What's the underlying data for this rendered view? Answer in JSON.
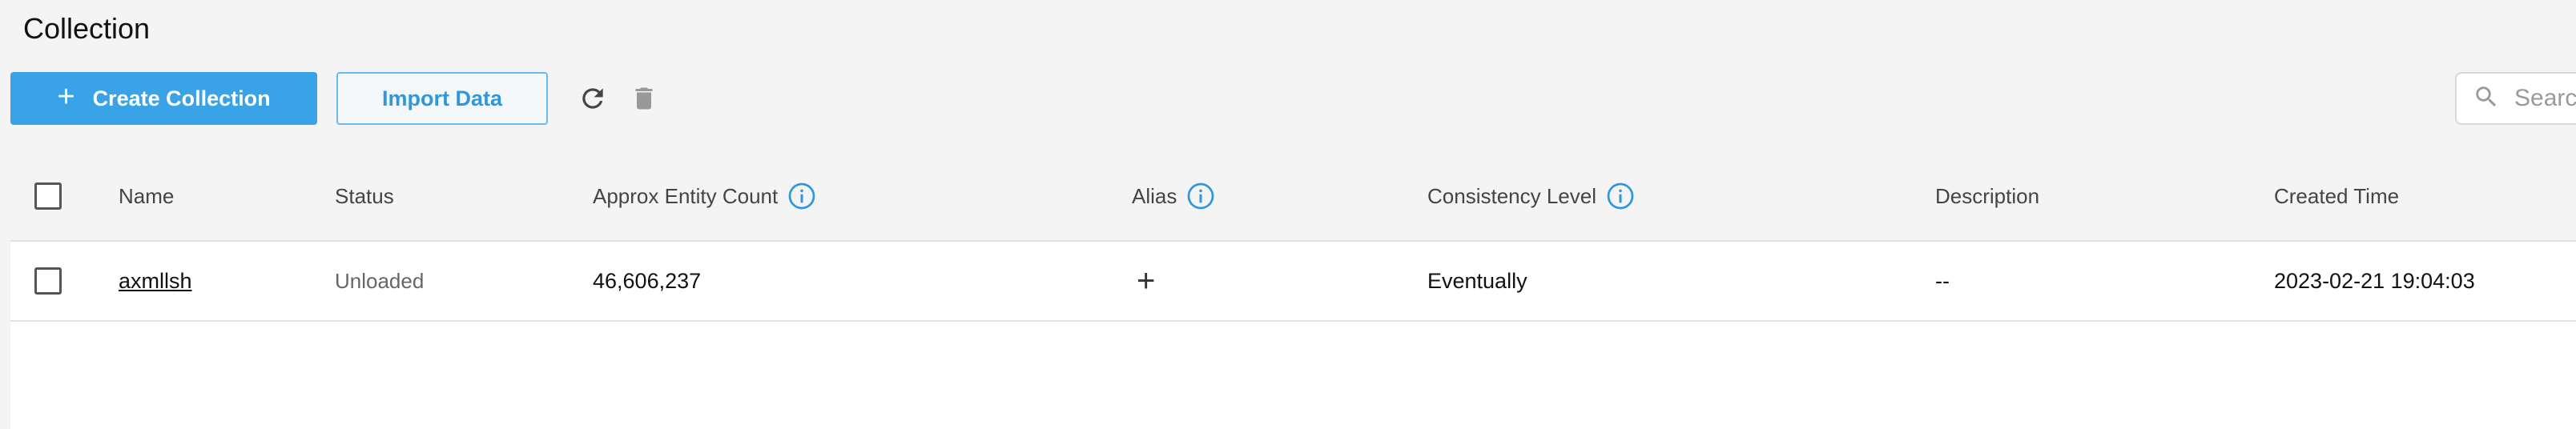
{
  "page": {
    "title": "Collection"
  },
  "toolbar": {
    "create_label": "Create Collection",
    "create_icon": "plus-icon",
    "import_label": "Import Data",
    "refresh_icon": "refresh-icon",
    "delete_icon": "trash-icon",
    "search_placeholder": "Search",
    "search_icon": "search-icon"
  },
  "table": {
    "columns": [
      {
        "label": "Name",
        "info": false
      },
      {
        "label": "Status",
        "info": false
      },
      {
        "label": "Approx Entity Count",
        "info": true
      },
      {
        "label": "Alias",
        "info": true
      },
      {
        "label": "Consistency Level",
        "info": true
      },
      {
        "label": "Description",
        "info": false
      },
      {
        "label": "Created Time",
        "info": false
      }
    ],
    "rows": [
      {
        "name": "axmllsh",
        "status": "Unloaded",
        "entity_count": "46,606,237",
        "alias": "+",
        "consistency": "Eventually",
        "description": "--",
        "created": "2023-02-21 19:04:03"
      }
    ]
  },
  "colors": {
    "primary": "#3aa2e6",
    "info_icon": "#2f98dd",
    "background": "#f4f4f4"
  }
}
